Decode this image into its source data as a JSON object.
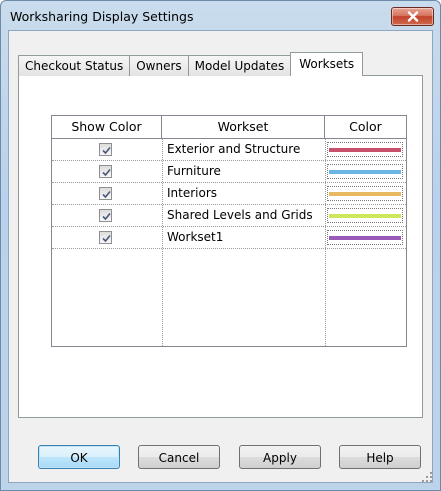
{
  "window": {
    "title": "Worksharing Display Settings"
  },
  "tabs": [
    {
      "label": "Checkout Status",
      "active": false
    },
    {
      "label": "Owners",
      "active": false
    },
    {
      "label": "Model Updates",
      "active": false
    },
    {
      "label": "Worksets",
      "active": true
    }
  ],
  "grid": {
    "columns": [
      "Show Color",
      "Workset",
      "Color"
    ],
    "rows": [
      {
        "show_color": true,
        "workset": "Exterior and Structure",
        "color": "#c8506a"
      },
      {
        "show_color": true,
        "workset": "Furniture",
        "color": "#6ab4e6"
      },
      {
        "show_color": true,
        "workset": "Interiors",
        "color": "#e8b860"
      },
      {
        "show_color": true,
        "workset": "Shared Levels and Grids",
        "color": "#cce85a"
      },
      {
        "show_color": true,
        "workset": "Workset1",
        "color": "#9a5ab8"
      }
    ]
  },
  "buttons": {
    "ok": "OK",
    "cancel": "Cancel",
    "apply": "Apply",
    "help": "Help"
  },
  "colors": {
    "titlebar": "#bcd3ea",
    "close_button": "#c2412a",
    "default_button_border": "#3c7fb1"
  }
}
